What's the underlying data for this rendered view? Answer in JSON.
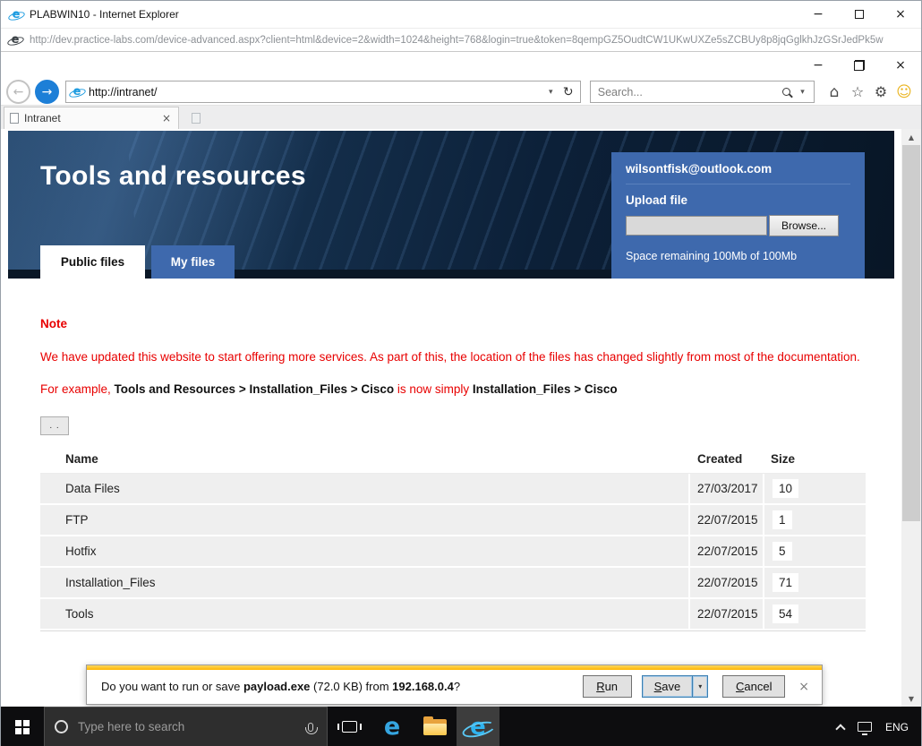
{
  "icons": {
    "minimize": "−",
    "close": "×",
    "back": "←",
    "forward": "→",
    "caret_down": "▾",
    "refresh": "↻",
    "home": "⌂",
    "favorites": "☆",
    "settings": "⚙",
    "feedback": "☺",
    "scroll_up": "▲",
    "scroll_down": "▼",
    "tab_close": "×",
    "notif_close": "×",
    "save_caret": "▼",
    "e_logo": "e"
  },
  "local_window": {
    "title": "PLABWIN10 - Internet Explorer",
    "url": "http://dev.practice-labs.com/device-advanced.aspx?client=html&device=2&width=1024&height=768&login=true&token=8qempGZ5OudtCW1UKwUXZe5sZCBUy8p8jqGglkhJzGSrJedPk5w"
  },
  "browser": {
    "address": "http://intranet/",
    "search_placeholder": "Search...",
    "tab_title": "Intranet"
  },
  "page": {
    "heading": "Tools and resources",
    "account_email": "wilsontfisk@outlook.com",
    "upload_label": "Upload file",
    "browse_button": "Browse...",
    "space_text": "Space remaining 100Mb of 100Mb",
    "tab_public": "Public files",
    "tab_my": "My files",
    "note_title": "Note",
    "note_body": "We have updated this website to start offering more services. As part of this, the location of the files has changed slightly from most of the documentation.",
    "example_prefix": "For example, ",
    "example_old": "Tools and Resources > Installation_Files > Cisco",
    "example_mid": " is now simply ",
    "example_new": "Installation_Files > Cisco",
    "up_button": ". .",
    "table": {
      "headers": [
        "Name",
        "Created",
        "Size"
      ],
      "rows": [
        {
          "name": "Data Files",
          "created": "27/03/2017",
          "size": "10"
        },
        {
          "name": "FTP",
          "created": "22/07/2015",
          "size": "1"
        },
        {
          "name": "Hotfix",
          "created": "22/07/2015",
          "size": "5"
        },
        {
          "name": "Installation_Files",
          "created": "22/07/2015",
          "size": "71"
        },
        {
          "name": "Tools",
          "created": "22/07/2015",
          "size": "54"
        }
      ]
    }
  },
  "download_bar": {
    "prefix": "Do you want to run or save ",
    "filename": "payload.exe",
    "mid": " (72.0 KB) from ",
    "host": "192.168.0.4",
    "suffix": "?",
    "run": "Run",
    "save": "Save",
    "cancel": "Cancel"
  },
  "taskbar": {
    "search_placeholder": "Type here to search",
    "language": "ENG"
  },
  "colors": {
    "accent_blue": "#3e69ad",
    "hero_navy": "#0a1a2c",
    "alert_red": "#e80000",
    "notif_stripe": "#feb500",
    "forward_blue": "#1d7fd7"
  }
}
